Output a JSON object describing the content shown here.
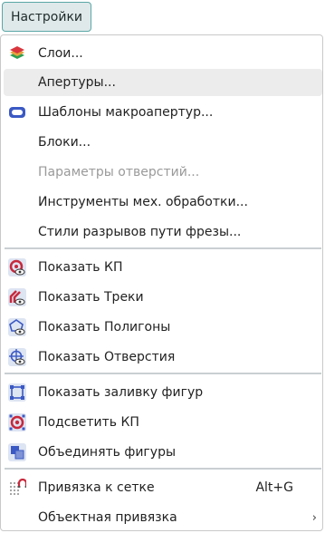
{
  "menubar": {
    "button_label": "Настройки"
  },
  "colors": {
    "accent": "#5aa7a5",
    "icon_red": "#c8283c",
    "icon_blue": "#3b59c4"
  },
  "menu": {
    "items": [
      {
        "label": "Слои...",
        "icon": "layers-icon"
      },
      {
        "label": "Апертуры..."
      },
      {
        "label": "Шаблоны макроапертур...",
        "icon": "macro-aperture-icon"
      },
      {
        "label": "Блоки..."
      },
      {
        "label": "Параметры отверстий...",
        "disabled": true
      },
      {
        "label": "Инструменты мех. обработки..."
      },
      {
        "label": "Стили разрывов пути фрезы..."
      },
      {
        "label": "Показать КП",
        "icon": "show-pads-icon"
      },
      {
        "label": "Показать Треки",
        "icon": "show-tracks-icon"
      },
      {
        "label": "Показать Полигоны",
        "icon": "show-polygons-icon"
      },
      {
        "label": "Показать Отверстия",
        "icon": "show-holes-icon"
      },
      {
        "label": "Показать заливку фигур",
        "icon": "fill-shapes-icon"
      },
      {
        "label": "Подсветить КП",
        "icon": "highlight-pads-icon"
      },
      {
        "label": "Объединять фигуры",
        "icon": "merge-shapes-icon"
      },
      {
        "label": "Привязка к сетке",
        "icon": "snap-grid-icon",
        "shortcut": "Alt+G"
      },
      {
        "label": "Объектная привязка",
        "submenu": true
      }
    ]
  }
}
